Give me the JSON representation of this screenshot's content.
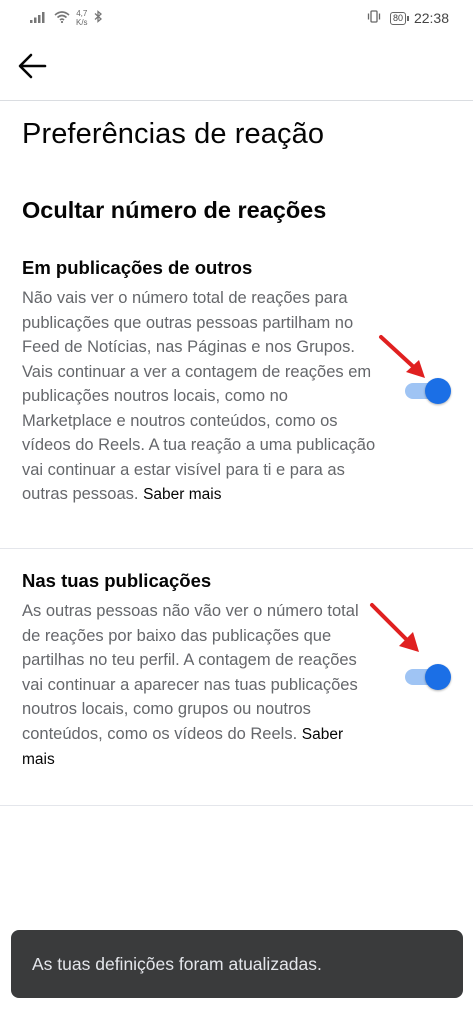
{
  "status_bar": {
    "net_speed_value": "4,7",
    "net_speed_unit": "K/s",
    "battery": "80",
    "time": "22:38"
  },
  "header": {
    "back_icon": "arrow-left-icon"
  },
  "page": {
    "title": "Preferências de reação",
    "section_title": "Ocultar número de reações"
  },
  "settings": [
    {
      "heading": "Em publicações de outros",
      "description": "Não vais ver o número total de reações para publicações que outras pessoas partilham no Feed de Notícias, nas Páginas e nos Grupos. Vais continuar a ver a contagem de reações em publicações noutros locais, como no Marketplace e noutros conteúdos, como os vídeos do Reels. A tua reação a uma publicação vai continuar a estar visível para ti e para as outras pessoas.",
      "link": "Saber mais",
      "enabled": true
    },
    {
      "heading": "Nas tuas publicações",
      "description": "As outras pessoas não vão ver o número total de reações por baixo das publicações que partilhas no teu perfil. A contagem de reações vai continuar a aparecer nas tuas publicações noutros locais, como grupos ou noutros conteúdos, como os vídeos do Reels.",
      "link": "Saber mais",
      "enabled": true
    }
  ],
  "snackbar": {
    "message": "As tuas definições foram atualizadas."
  },
  "colors": {
    "toggle_on": "#1b6fe6",
    "toggle_track": "#9fc4f4",
    "annotation_arrow": "#e02020",
    "snackbar_bg": "#3a3b3c"
  }
}
